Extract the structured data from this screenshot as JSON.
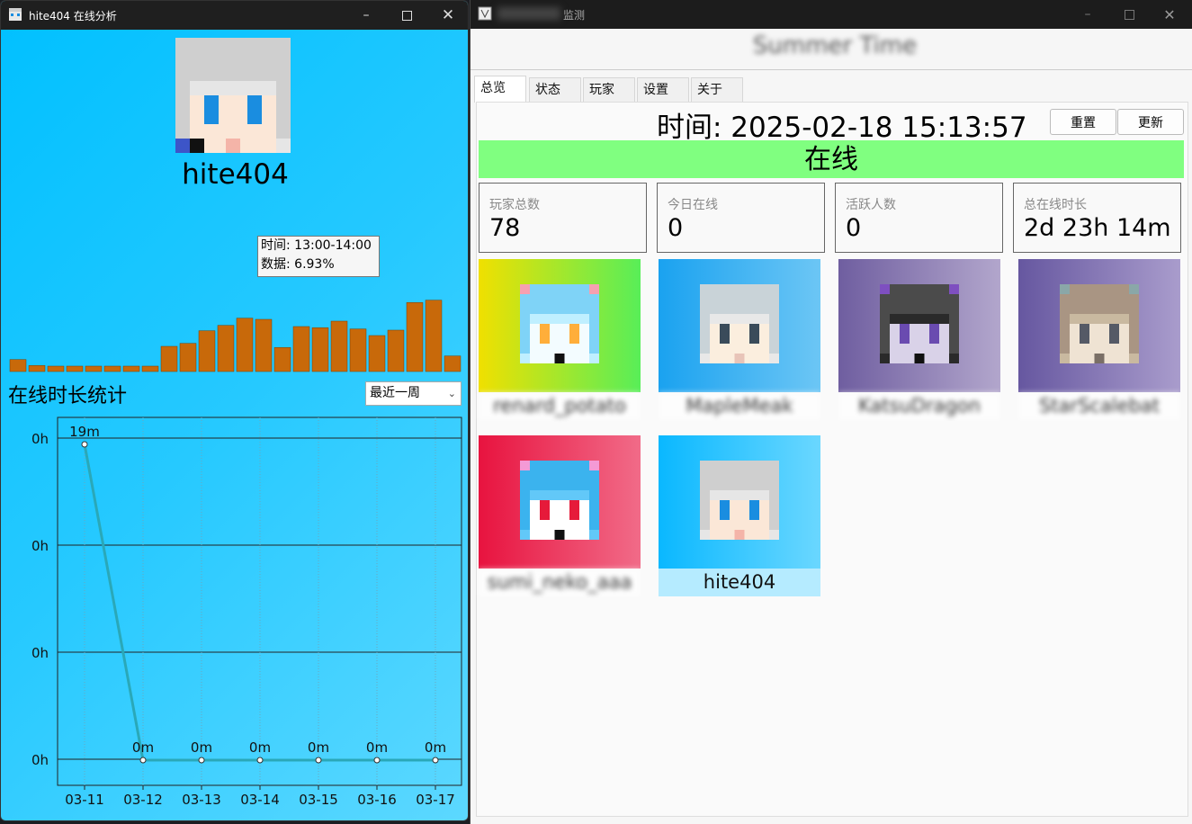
{
  "left_window": {
    "title": "hite404 在线分析",
    "player_name": "hite404",
    "tooltip": {
      "time": "时间: 13:00-14:00",
      "data": "数据: 6.93%"
    },
    "section_title": "在线时长统计",
    "range_select": "最近一周",
    "hourly_bars": [
      2.0,
      1.0,
      0.9,
      0.9,
      0.9,
      0.9,
      0.9,
      0.9,
      4.2,
      4.7,
      6.8,
      7.7,
      8.9,
      8.7,
      4.0,
      7.5,
      7.3,
      8.4,
      7.1,
      6.0,
      6.9,
      11.5,
      11.9,
      2.6
    ],
    "tooltip_index": 13,
    "colors": {
      "bar": "#c8690a",
      "line": "#2aa8b8"
    }
  },
  "right_window": {
    "title": "监测",
    "server_name": "Summer Time",
    "tabs": [
      "总览",
      "状态",
      "玩家",
      "设置",
      "关于"
    ],
    "active_tab": 0,
    "time_display": "时间: 2025-02-18 15:13:57",
    "buttons": {
      "reset": "重置",
      "update": "更新"
    },
    "status": "在线",
    "status_color": "#80ff80",
    "stats": [
      {
        "label": "玩家总数",
        "value": "78"
      },
      {
        "label": "今日在线",
        "value": "0"
      },
      {
        "label": "活跃人数",
        "value": "0"
      },
      {
        "label": "总在线时长",
        "value": "2d 23h 14m"
      }
    ],
    "players": [
      {
        "name": "renard_potato",
        "grad": [
          "#f0e000",
          "#58ee58"
        ],
        "skin": "cat-blue",
        "blurred": true
      },
      {
        "name": "MapleMeak",
        "grad": [
          "#1aa2f0",
          "#6cc6f5"
        ],
        "skin": "hair-white",
        "blurred": true
      },
      {
        "name": "KatsuDragon",
        "grad": [
          "#6f5ea0",
          "#b2a6cc"
        ],
        "skin": "cat-black",
        "blurred": true
      },
      {
        "name": "StarScalebat",
        "grad": [
          "#6657a0",
          "#a99ccc"
        ],
        "skin": "goggles",
        "blurred": true
      },
      {
        "name": "sumi_neko_aaa",
        "grad": [
          "#e8133f",
          "#f16b88"
        ],
        "skin": "cat-blue2",
        "blurred": true
      },
      {
        "name": "hite404",
        "grad": [
          "#0ab8ff",
          "#6ad7ff"
        ],
        "skin": "hite",
        "blurred": false
      }
    ]
  },
  "chart_data": {
    "type": "line",
    "title": "在线时长统计",
    "x": [
      "03-11",
      "03-12",
      "03-13",
      "03-14",
      "03-15",
      "03-16",
      "03-17"
    ],
    "values": [
      19,
      0,
      0,
      0,
      0,
      0,
      0
    ],
    "point_labels": [
      "19m",
      "0m",
      "0m",
      "0m",
      "0m",
      "0m",
      "0m"
    ],
    "y_tick_labels": [
      "0h",
      "0h",
      "0h",
      "0h"
    ],
    "xlabel": "",
    "ylabel": "",
    "ylim": [
      0,
      19
    ],
    "grid": true
  }
}
